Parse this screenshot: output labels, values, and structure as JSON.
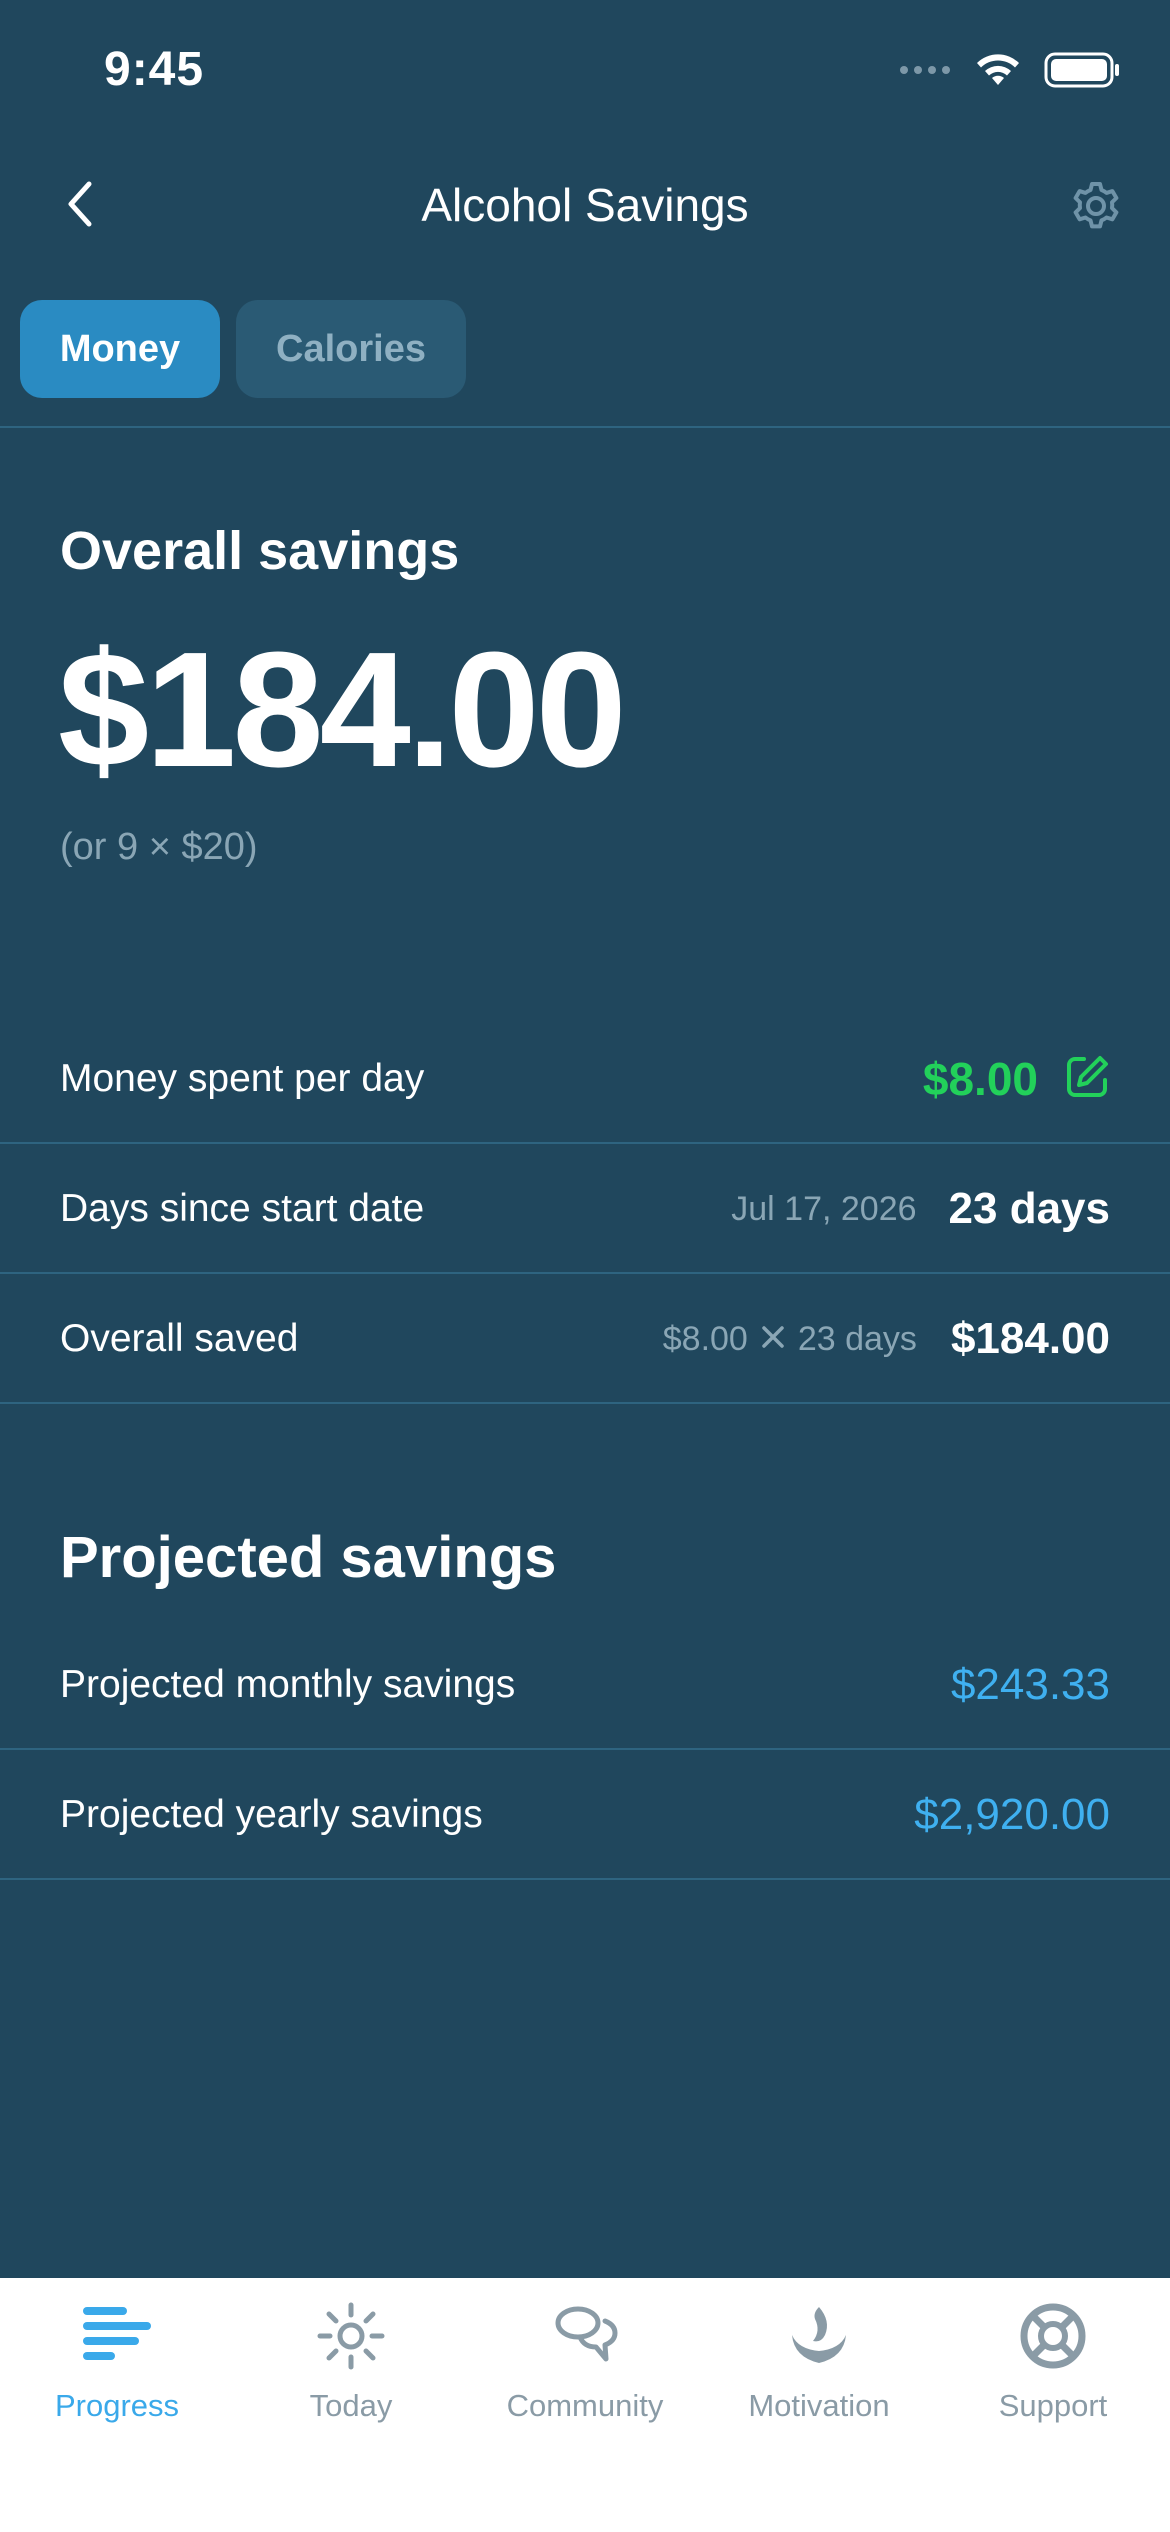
{
  "status_bar": {
    "time": "9:45"
  },
  "nav": {
    "title": "Alcohol Savings"
  },
  "tabs": [
    {
      "label": "Money",
      "active": true
    },
    {
      "label": "Calories",
      "active": false
    }
  ],
  "overall": {
    "heading": "Overall savings",
    "amount": "$184.00",
    "alt_amount": "(or 9 × $20)"
  },
  "rows": {
    "money_per_day": {
      "label": "Money spent per day",
      "value": "$8.00"
    },
    "days_since": {
      "label": "Days since start date",
      "date": "Jul 17, 2026",
      "value": "23 days"
    },
    "overall_saved": {
      "label": "Overall saved",
      "calc_rate": "$8.00",
      "calc_days": "23 days",
      "value": "$184.00"
    }
  },
  "projected": {
    "heading": "Projected savings",
    "monthly": {
      "label": "Projected monthly savings",
      "value": "$243.33"
    },
    "yearly": {
      "label": "Projected yearly savings",
      "value": "$2,920.00"
    }
  },
  "bottom_tabs": [
    {
      "label": "Progress",
      "icon": "progress-bars-icon",
      "active": true
    },
    {
      "label": "Today",
      "icon": "sun-icon",
      "active": false
    },
    {
      "label": "Community",
      "icon": "chat-bubbles-icon",
      "active": false
    },
    {
      "label": "Motivation",
      "icon": "flame-hands-icon",
      "active": false
    },
    {
      "label": "Support",
      "icon": "lifebuoy-icon",
      "active": false
    }
  ],
  "colors": {
    "background": "#20475d",
    "accent_green": "#22d15a",
    "accent_blue": "#3fb0f0",
    "tab_active": "#2a8bc2",
    "tab_bar_active": "#3aa9ea",
    "tab_bar_inactive": "#8a9ba6"
  }
}
